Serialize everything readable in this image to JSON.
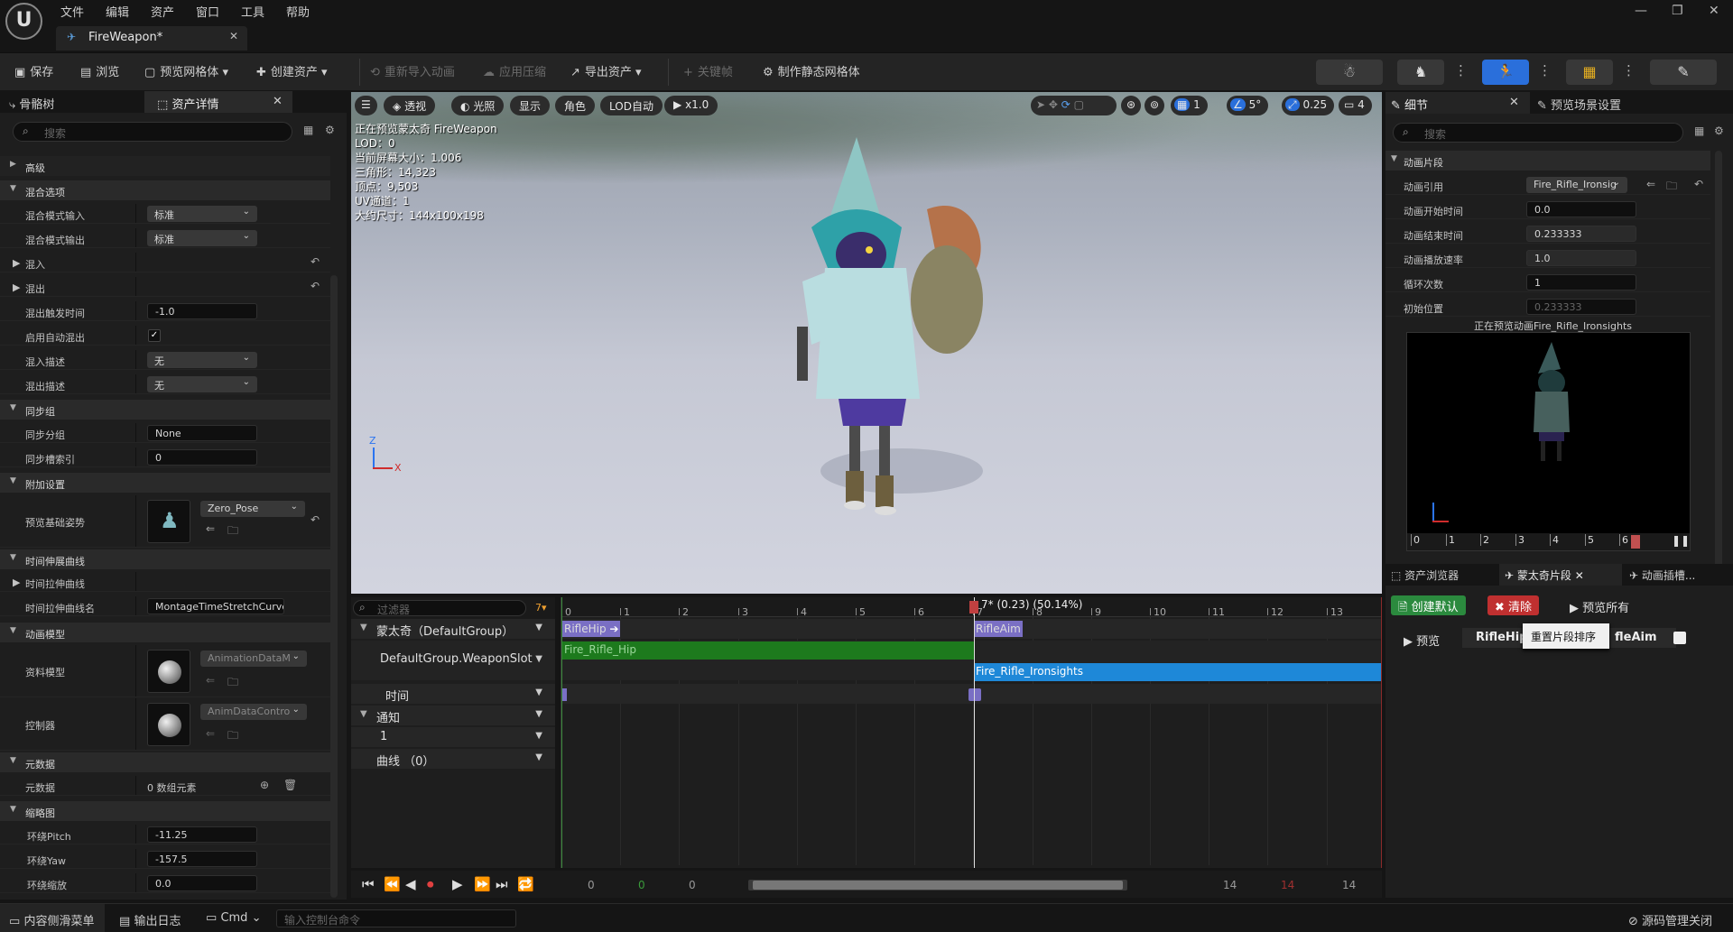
{
  "menu": [
    "文件",
    "编辑",
    "资产",
    "窗口",
    "工具",
    "帮助"
  ],
  "document_tab": {
    "title": "FireWeapon*"
  },
  "toolbar": {
    "save": "保存",
    "browse": "浏览",
    "preview_mesh": "预览网格体",
    "create_asset": "创建资产",
    "reimport": "重新导入动画",
    "apply_compression": "应用压缩",
    "export_asset": "导出资产",
    "keyframe": "关键帧",
    "make_static_mesh": "制作静态网格体"
  },
  "left_panel": {
    "tabs": [
      "骨骼树",
      "资产详情"
    ],
    "search_placeholder": "搜索",
    "sections": {
      "advanced": "高级",
      "blend_options": "混合选项",
      "sync_group": "同步组",
      "additive": "附加设置",
      "time_stretch": "时间伸展曲线",
      "anim_model": "动画模型",
      "metadata": "元数据",
      "thumbnail": "缩略图"
    },
    "rows": {
      "blend_mode_in": {
        "label": "混合模式输入",
        "value": "标准"
      },
      "blend_mode_out": {
        "label": "混合模式输出",
        "value": "标准"
      },
      "blend_in": {
        "label": "混入"
      },
      "blend_out": {
        "label": "混出"
      },
      "blend_out_trigger": {
        "label": "混出触发时间",
        "value": "-1.0"
      },
      "auto_blend_out": {
        "label": "启用自动混出"
      },
      "blend_in_profile": {
        "label": "混入描述",
        "value": "无"
      },
      "blend_out_profile": {
        "label": "混出描述",
        "value": "无"
      },
      "sync_group_name": {
        "label": "同步分组",
        "value": "None"
      },
      "sync_slot_index": {
        "label": "同步槽索引",
        "value": "0"
      },
      "preview_base_pose": {
        "label": "预览基础姿势",
        "value": "Zero_Pose"
      },
      "time_stretch_curve": {
        "label": "时间拉伸曲线"
      },
      "time_stretch_curve_name": {
        "label": "时间拉伸曲线名",
        "value": "MontageTimeStretchCurve"
      },
      "data_model": {
        "label": "资料模型",
        "value": "AnimationDataM"
      },
      "controller": {
        "label": "控制器",
        "value": "AnimDataContro"
      },
      "metadata": {
        "label": "元数据",
        "value": "0 数组元素"
      },
      "orbit_pitch": {
        "label": "环绕Pitch",
        "value": "-11.25"
      },
      "orbit_yaw": {
        "label": "环绕Yaw",
        "value": "-157.5"
      },
      "orbit_zoom": {
        "label": "环绕缩放",
        "value": "0.0"
      }
    }
  },
  "viewport": {
    "buttons": {
      "perspective": "透视",
      "lit": "光照",
      "show": "显示",
      "character": "角色",
      "lod": "LOD自动",
      "speed": "x1.0",
      "grid_val": "1",
      "angle_val": "5°",
      "scale_val": "0.25",
      "cam_val": "4"
    },
    "info": [
      "正在预览蒙太奇 FireWeapon",
      "LOD：0",
      "当前屏幕大小：1.006",
      "三角形：14,323",
      "顶点：9,503",
      "UV通道：1",
      "大约尺寸：144x100x198"
    ]
  },
  "timeline": {
    "filter_placeholder": "过滤器",
    "filter_badge": "7▾",
    "rows": {
      "montage": "蒙太奇（DefaultGroup）",
      "slot": "DefaultGroup.WeaponSlot",
      "time": "时间",
      "notify": "通知",
      "notify_track": "1",
      "curves": "曲线 （0）"
    },
    "ticks": [
      "0",
      "1",
      "2",
      "3",
      "4",
      "5",
      "6",
      "7",
      "8",
      "9",
      "10",
      "11",
      "12",
      "13"
    ],
    "playhead_label": "7* (0.23) (50.14%)",
    "sections": [
      "RifleHip",
      "RifleAim"
    ],
    "segments": [
      "Fire_Rifle_Hip",
      "Fire_Rifle_Ironsights"
    ],
    "transport": {
      "start": "0",
      "start2": "0",
      "start3": "0",
      "end": "14",
      "end2": "14",
      "end3": "14"
    }
  },
  "right_panel": {
    "tabs": [
      "细节",
      "预览场景设置"
    ],
    "search_placeholder": "搜索",
    "section": "动画片段",
    "rows": {
      "anim_ref": {
        "label": "动画引用",
        "value": "Fire_Rifle_Ironsig"
      },
      "start_time": {
        "label": "动画开始时间",
        "value": "0.0"
      },
      "end_time": {
        "label": "动画结束时间",
        "value": "0.233333"
      },
      "play_rate": {
        "label": "动画播放速率",
        "value": "1.0"
      },
      "loop_count": {
        "label": "循环次数",
        "value": "1"
      },
      "start_pos": {
        "label": "初始位置",
        "value": "0.233333"
      }
    },
    "preview_caption": "正在预览动画Fire_Rifle_Ironsights",
    "mini_ticks": [
      "0",
      "1",
      "2",
      "3",
      "4",
      "5",
      "6"
    ],
    "bottom_tabs": [
      "资产浏览器",
      "蒙太奇片段",
      "动画插槽..."
    ],
    "create_default": "创建默认",
    "clear": "清除",
    "preview_all": "预览所有",
    "tooltip": "重置片段排序",
    "preview": "预览",
    "sec1": "RifleHip",
    "sec2": "fleAim"
  },
  "status_bar": {
    "content_drawer": "内容侧滑菜单",
    "output_log": "输出日志",
    "cmd": "Cmd",
    "console_placeholder": "输入控制台命令",
    "source_control": "源码管理关闭"
  },
  "colors": {
    "accent_blue": "#2a6fdb",
    "segment_green": "#1d7a1d",
    "segment_blue": "#1e88d8",
    "section_purple": "#7a6fc4"
  }
}
